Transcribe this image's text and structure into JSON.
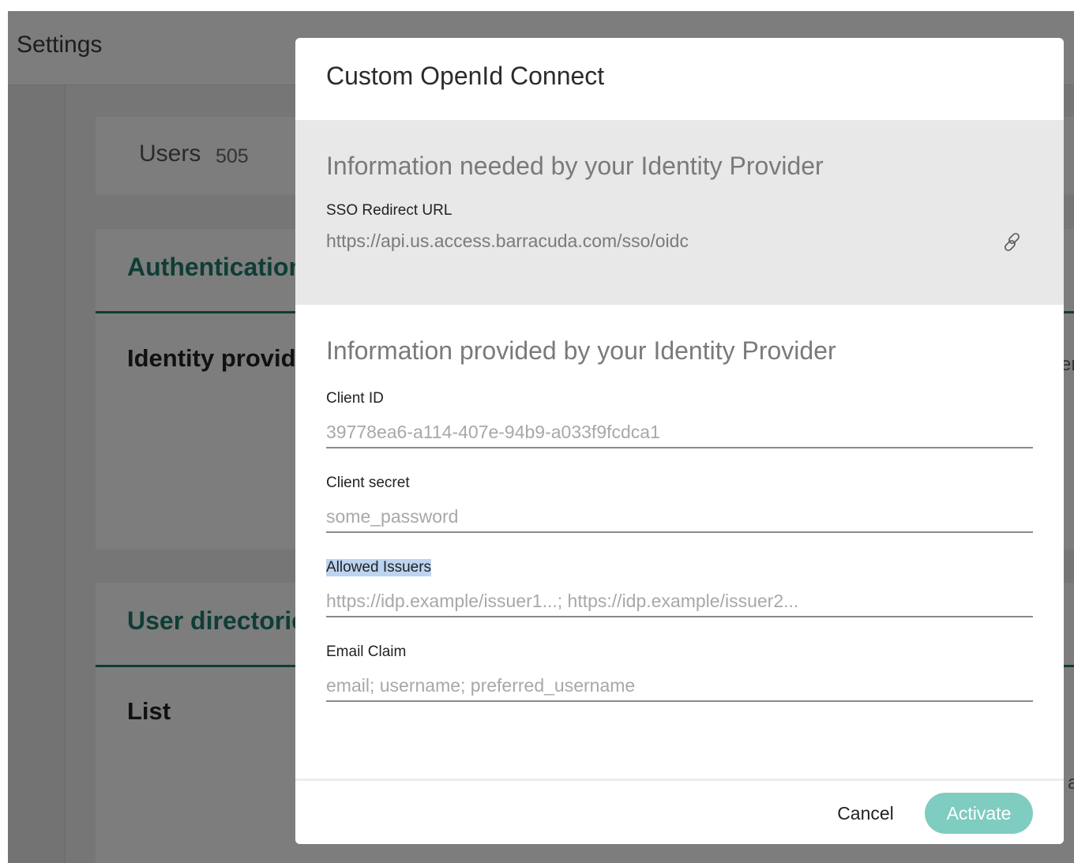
{
  "app": {
    "title": "Settings",
    "users_label": "Users",
    "users_count": "505",
    "auth_tab": "Authentication",
    "identity_providers_heading": "Identity providers",
    "user_directories_tab": "User directories",
    "list_heading": "List",
    "edge_glyph_1": "er",
    "edge_glyph_2": "a"
  },
  "modal": {
    "title": "Custom OpenId Connect",
    "needed": {
      "heading": "Information needed by your Identity Provider",
      "redirect_label": "SSO Redirect URL",
      "redirect_url": "https://api.us.access.barracuda.com/sso/oidc",
      "copy_icon": "link-icon"
    },
    "provided": {
      "heading": "Information provided by your Identity Provider",
      "fields": [
        {
          "label": "Client ID",
          "value": "",
          "placeholder": "39778ea6-a114-407e-94b9-a033f9fcdca1"
        },
        {
          "label": "Client secret",
          "value": "",
          "placeholder": "some_password"
        },
        {
          "label": "Allowed Issuers",
          "value": "",
          "placeholder": "https://idp.example/issuer1...; https://idp.example/issuer2..."
        },
        {
          "label": "Email Claim",
          "value": "",
          "placeholder": "email; username; preferred_username"
        }
      ]
    },
    "footer": {
      "cancel_label": "Cancel",
      "activate_label": "Activate"
    }
  },
  "colors": {
    "accent": "#1f7a6b",
    "activate_disabled": "#7fccc0",
    "selection": "#bcd4ef"
  }
}
